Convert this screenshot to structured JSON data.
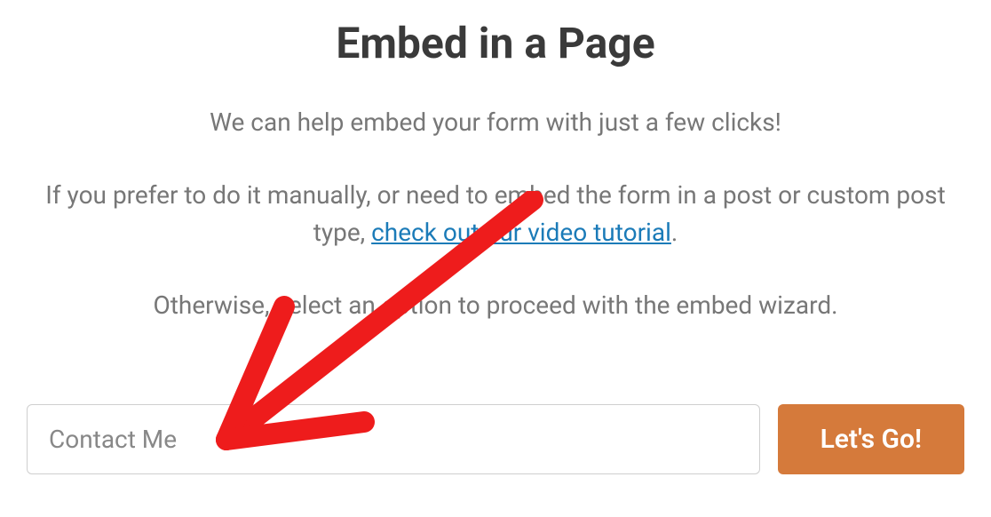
{
  "modal": {
    "title": "Embed in a Page",
    "subtitle": "We can help embed your form with just a few clicks!",
    "manual_prefix": "If you prefer to do it manually, or need to embed the form in a post or custom post type, ",
    "link_text": "check out our video tutorial",
    "manual_suffix": ".",
    "wizard_text": "Otherwise, select an option to proceed with the embed wizard.",
    "input_value": "Contact Me",
    "button_label": "Let's Go!"
  }
}
